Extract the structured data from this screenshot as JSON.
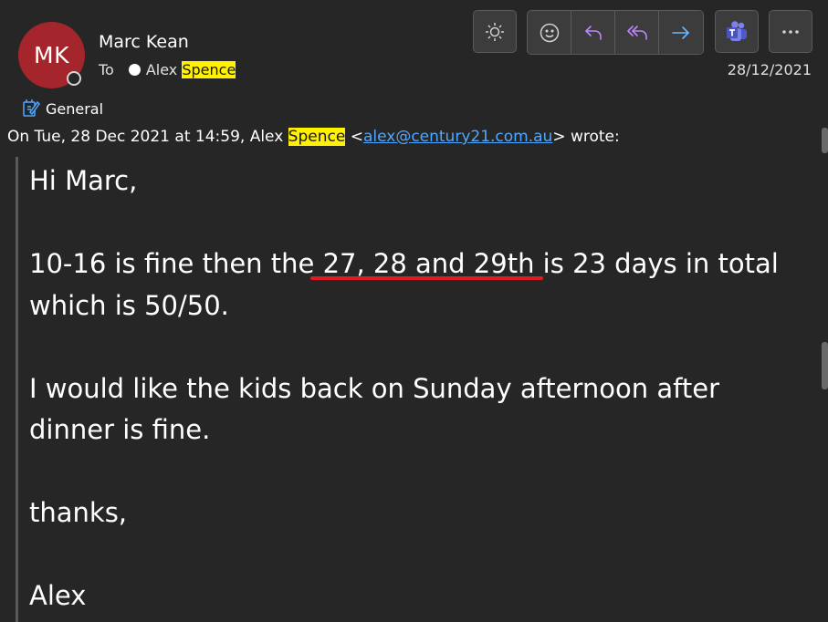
{
  "header": {
    "avatar_initials": "MK",
    "sender_name": "Marc Kean",
    "to_label": "To",
    "recipient_first": "Alex ",
    "recipient_highlight": "Spence",
    "date": "28/12/2021"
  },
  "toolbar": {
    "buttons": [
      "brightness-icon",
      "emoji-icon",
      "reply-icon",
      "reply-all-icon",
      "forward-icon",
      "teams-icon",
      "more-icon"
    ]
  },
  "category": {
    "label": "General"
  },
  "quote_header": {
    "prefix": "On Tue, 28 Dec 2021 at 14:59, Alex ",
    "name_highlight": "Spence",
    "lt": " <",
    "email": "alex@century21.com.au",
    "suffix": "> wrote:"
  },
  "body": {
    "greeting": "Hi Marc,",
    "line1a": "10-16 is fine then the 27, 28 and 29th is 23 days in total",
    "line1b": "which is 50/50.",
    "line2a": "I would like the kids back on Sunday afternoon after",
    "line2b": "dinner is fine.",
    "thanks": "thanks,",
    "signature": "Alex"
  },
  "colors": {
    "background": "#262626",
    "avatar": "#a4262c",
    "highlight": "#fff100",
    "link": "#4fa8ff",
    "spell_error": "#e01b24",
    "reply_accent": "#c084fc",
    "forward_accent": "#6cb8ff"
  }
}
